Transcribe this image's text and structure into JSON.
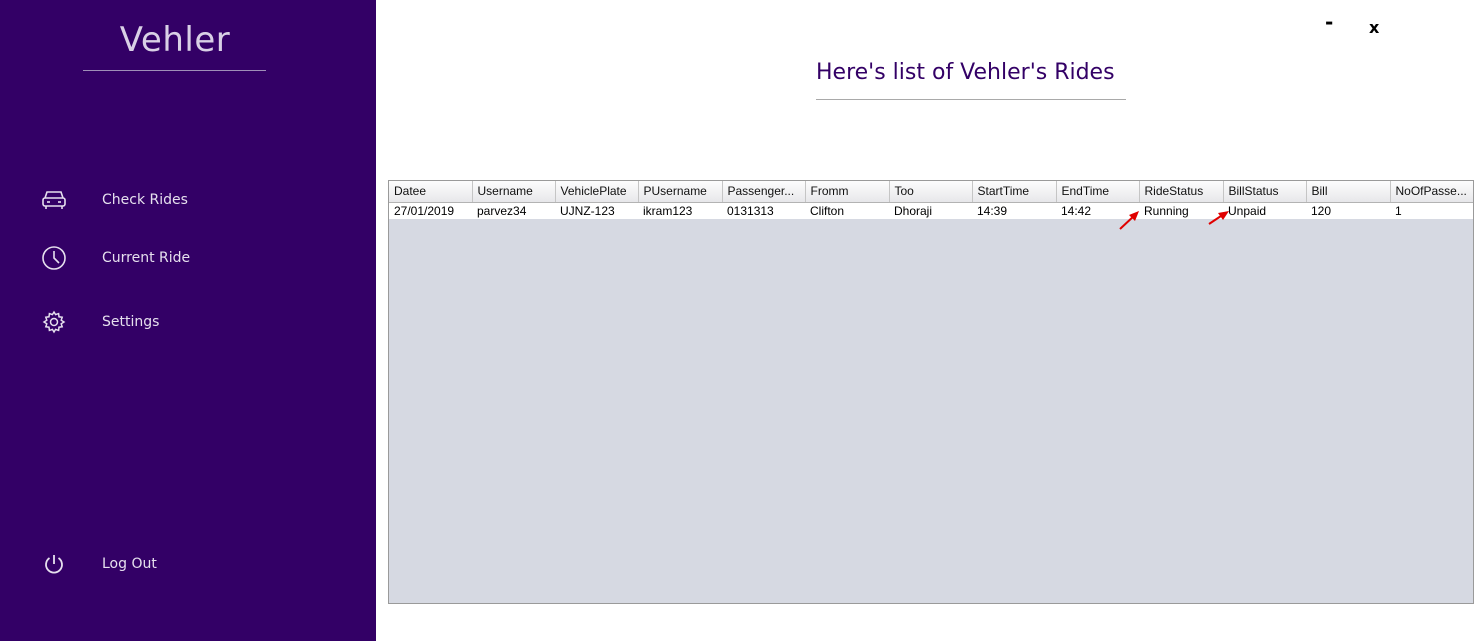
{
  "app": {
    "brand": "Vehler"
  },
  "sidebar": {
    "items": [
      {
        "label": "Check Rides",
        "icon": "car-icon"
      },
      {
        "label": "Current Ride",
        "icon": "clock-icon"
      },
      {
        "label": "Settings",
        "icon": "gear-icon"
      },
      {
        "label": "Log Out",
        "icon": "power-icon"
      }
    ]
  },
  "window": {
    "minimize_label": "-",
    "close_label": "x"
  },
  "main": {
    "heading": "Here's list of Vehler's Rides"
  },
  "table": {
    "columns": [
      "Datee",
      "Username",
      "VehiclePlate",
      "PUsername",
      "Passenger...",
      "Fromm",
      "Too",
      "StartTime",
      "EndTime",
      "RideStatus",
      "BillStatus",
      "Bill",
      "NoOfPasse..."
    ],
    "rows": [
      [
        "27/01/2019",
        "parvez34",
        "UJNZ-123",
        "ikram123",
        "0131313",
        "Clifton",
        "Dhoraji",
        "14:39",
        "14:42",
        "Running",
        "Unpaid",
        "120",
        "1"
      ]
    ]
  },
  "colors": {
    "sidebar_bg": "#330066",
    "heading": "#330066",
    "table_bg": "#d6d9e2",
    "annotation_arrow": "#e00000"
  }
}
